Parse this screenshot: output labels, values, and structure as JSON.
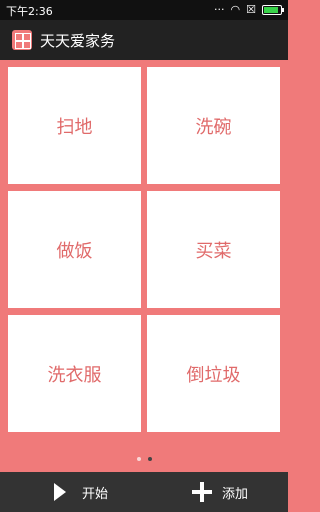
{
  "status_bar": {
    "time": "下午2:36",
    "icons": [
      "signal-icon",
      "wifi-icon",
      "sim-icon",
      "battery-icon"
    ]
  },
  "app": {
    "title": "天天爱家务",
    "accent": "#f07a7a"
  },
  "tiles": [
    {
      "label": "扫地"
    },
    {
      "label": "洗碗"
    },
    {
      "label": "做饭"
    },
    {
      "label": "买菜"
    },
    {
      "label": "洗衣服"
    },
    {
      "label": "倒垃圾"
    }
  ],
  "pager": {
    "total": 2,
    "active": 2
  },
  "bottom_bar": {
    "start_label": "开始",
    "add_label": "添加"
  }
}
